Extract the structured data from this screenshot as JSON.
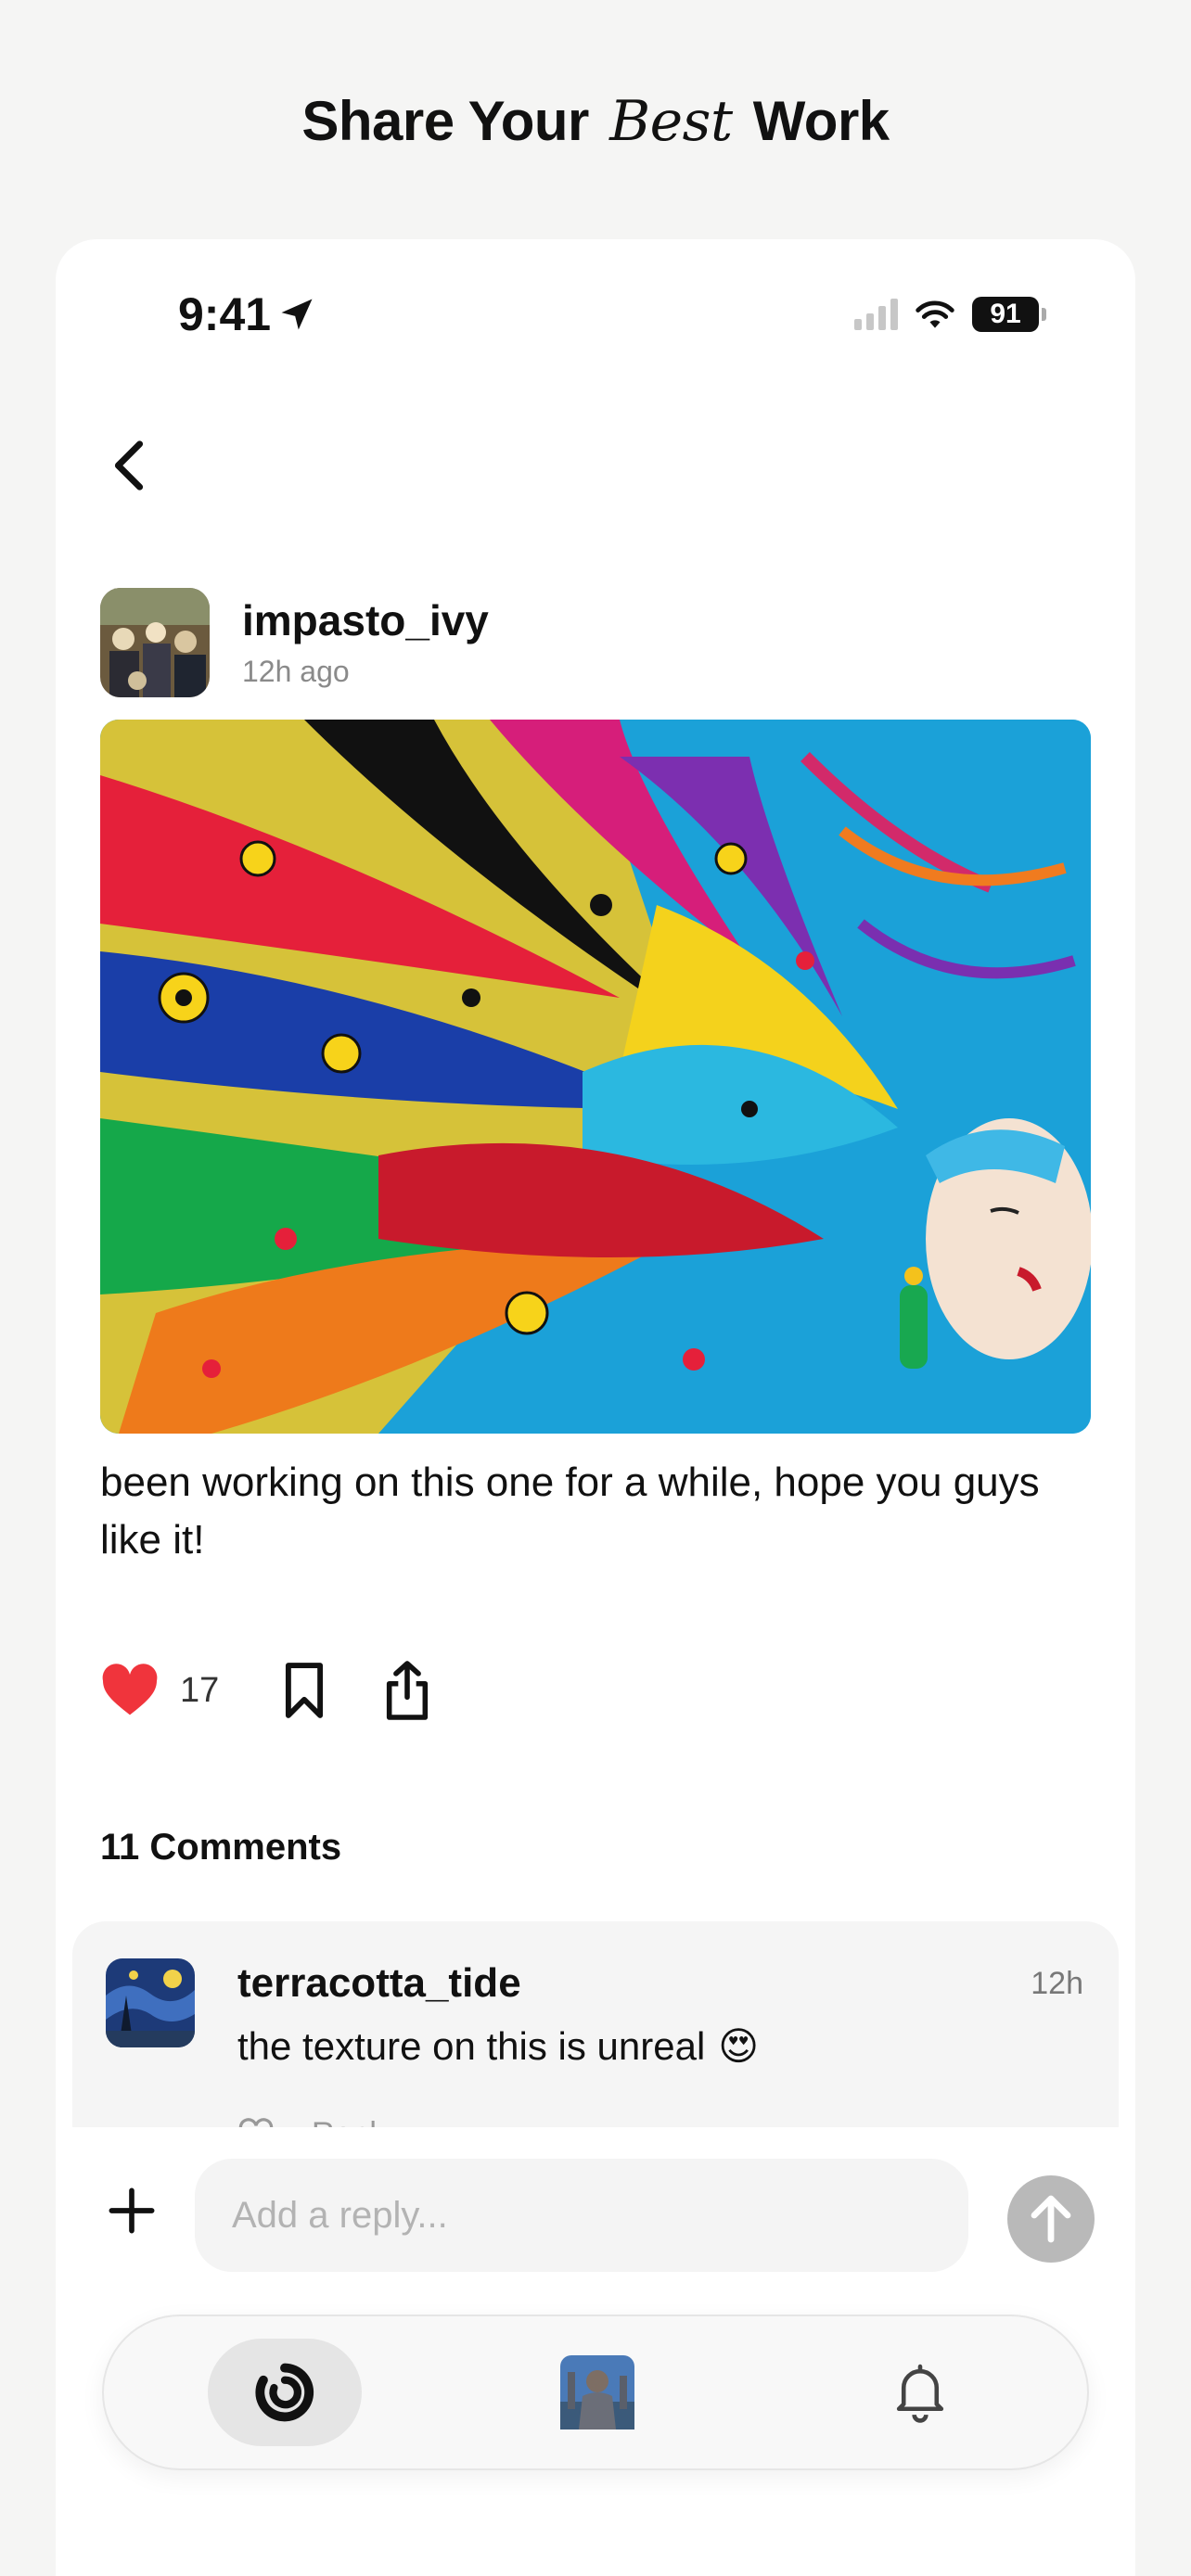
{
  "page": {
    "title_part1": "Share Your",
    "title_accent": "Best",
    "title_part2": "Work"
  },
  "status_bar": {
    "time": "9:41",
    "battery": "91"
  },
  "post": {
    "username": "impasto_ivy",
    "time_ago": "12h ago",
    "caption": "been working on this one for a while, hope you guys like it!",
    "like_count": "17",
    "liked": true
  },
  "comments": {
    "title": "11 Comments",
    "items": [
      {
        "user": "terracotta_tide",
        "time": "12h",
        "text": "the texture on this is unreal",
        "emoji": "😍",
        "reply_label": "Reply"
      }
    ]
  },
  "reply_bar": {
    "placeholder": "Add a reply..."
  },
  "tab_bar": {
    "active": "home"
  },
  "colors": {
    "like": "#f0343c",
    "send_button": "#b9b9b9",
    "background": "#f5f5f4"
  },
  "icons": [
    "location-arrow-icon",
    "signal-icon",
    "wifi-icon",
    "battery-icon",
    "back-chevron-icon",
    "heart-icon",
    "bookmark-icon",
    "share-icon",
    "plus-icon",
    "send-arrow-icon",
    "home-logo-icon",
    "bell-icon"
  ]
}
